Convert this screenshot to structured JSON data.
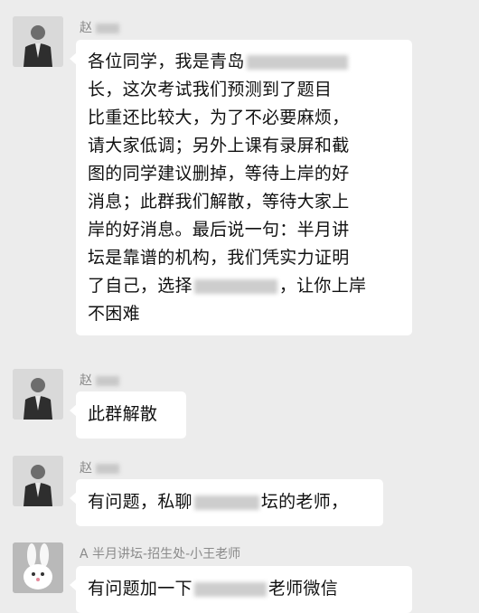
{
  "messages": [
    {
      "sender": "赵",
      "lines": [
        "各位同学，我是青岛",
        "长，这次考试我们预测到了题目",
        "比重还比较大，为了不必要麻烦，",
        "请大家低调；另外上课有录屏和截",
        "图的同学建议删掉，等待上岸的好",
        "消息；此群我们解散，等待大家上",
        "岸的好消息。最后说一句：半月讲",
        "坛是靠谱的机构，我们凭实力证明",
        "了自己，选择",
        "，让你上岸",
        "不困难"
      ]
    },
    {
      "sender": "赵",
      "text": "此群解散"
    },
    {
      "sender": "赵",
      "text_before": "有问题，私聊",
      "text_after": "坛的老师，"
    },
    {
      "sender": "A 半月讲坛-招生处-小王老师",
      "text_before": "有问题加一下",
      "text_after": "老师微信"
    }
  ]
}
